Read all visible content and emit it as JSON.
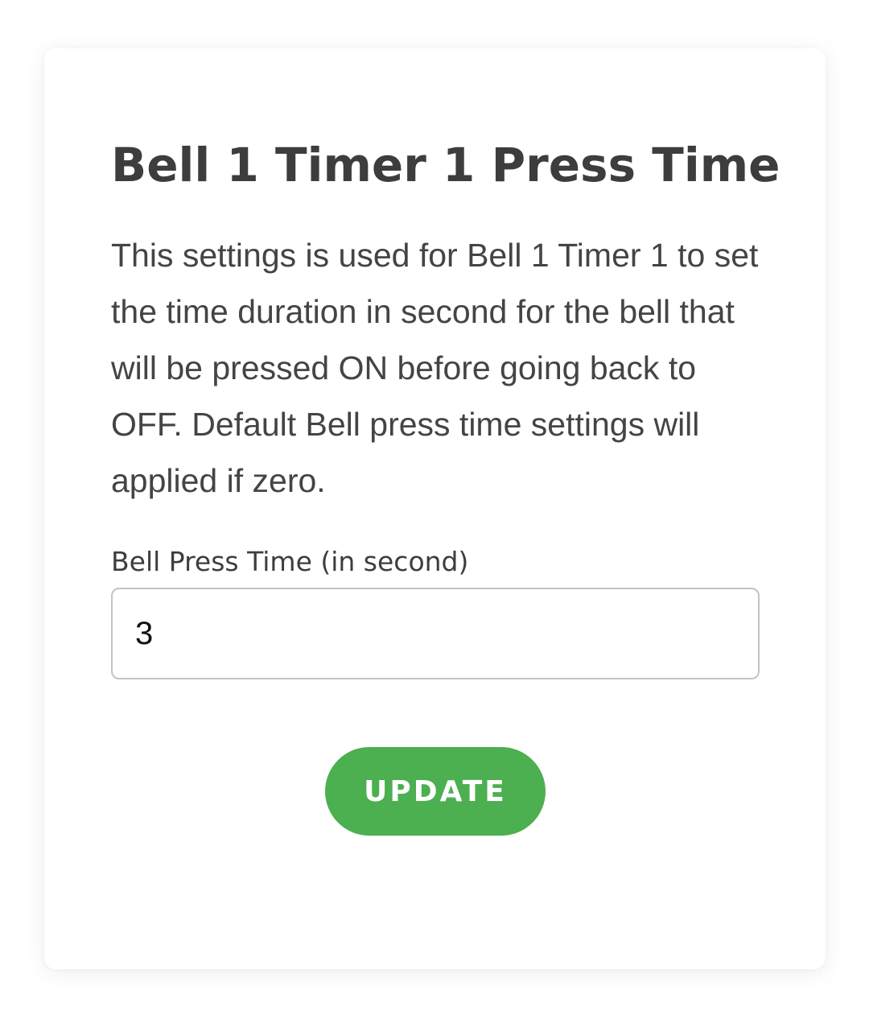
{
  "form": {
    "title": "Bell 1 Timer 1 Press Time",
    "description": "This settings is used for Bell 1 Timer 1 to set the time duration in second for the bell that will be pressed ON before going back to OFF. Default Bell press time settings will applied if zero.",
    "field_label": "Bell Press Time (in second)",
    "field_value": "3",
    "submit_label": "UPDATE"
  },
  "colors": {
    "accent": "#4caf50",
    "title_text": "#3d3d3d",
    "body_text": "#444444",
    "input_border": "#c4c4c4"
  }
}
